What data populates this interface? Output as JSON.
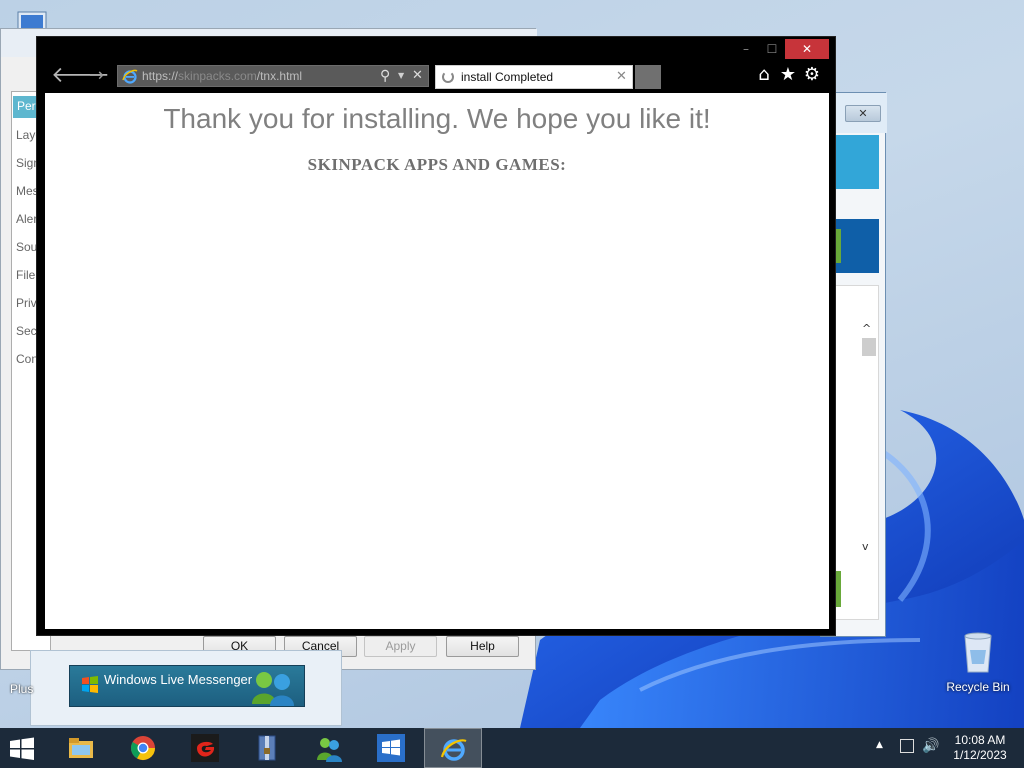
{
  "background_dialog": {
    "categories": [
      "Pers",
      "Laye",
      "Sign",
      "Mes",
      "Aler",
      "Sou",
      "File",
      "Priv",
      "Secu",
      "Con"
    ],
    "buttons": {
      "ok": "OK",
      "cancel": "Cancel",
      "apply": "Apply",
      "help": "Help"
    }
  },
  "messenger": {
    "banner_label": "Windows Live Messenger"
  },
  "desktop": {
    "plus_label": "Plus",
    "recycle_bin_label": "Recycle Bin"
  },
  "browser": {
    "address_prefix": "https://",
    "address_domain": "skinpacks.com",
    "address_path": "/tnx.html",
    "tab_title": "install Completed",
    "heading": "Thank you for installing. We hope you like it!",
    "subheading": "SKINPACK APPS AND GAMES:"
  },
  "taskbar": {
    "items": [
      "file-explorer",
      "chrome",
      "garena",
      "winrar",
      "messenger",
      "start-menu-app",
      "internet-explorer"
    ],
    "active_item": "internet-explorer"
  },
  "clock": {
    "time": "10:08 AM",
    "date": "1/12/2023"
  },
  "colors": {
    "accent_close": "#c7343a",
    "taskbar": "#1c2a3a",
    "heading_gray": "#808080",
    "bloom_blue": "#1a56d6"
  }
}
